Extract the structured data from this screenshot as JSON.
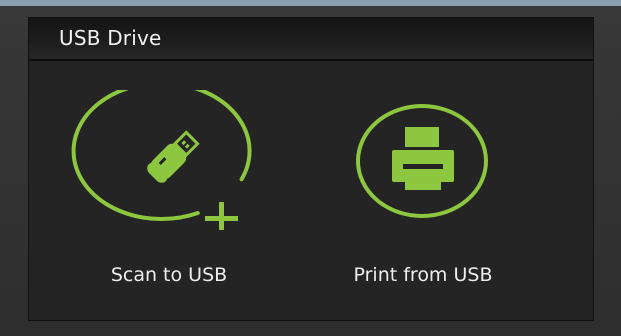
{
  "panel": {
    "title": "USB Drive"
  },
  "tiles": [
    {
      "label": "Scan to USB",
      "icon": "usb-drive-add-icon"
    },
    {
      "label": "Print from USB",
      "icon": "printer-icon"
    }
  ],
  "colors": {
    "accent": "#8dc63f",
    "panel_bg": "#242424",
    "header_bg": "#1a1a1a",
    "text": "#eeeeee",
    "top_bar": "#8aa0ad"
  }
}
